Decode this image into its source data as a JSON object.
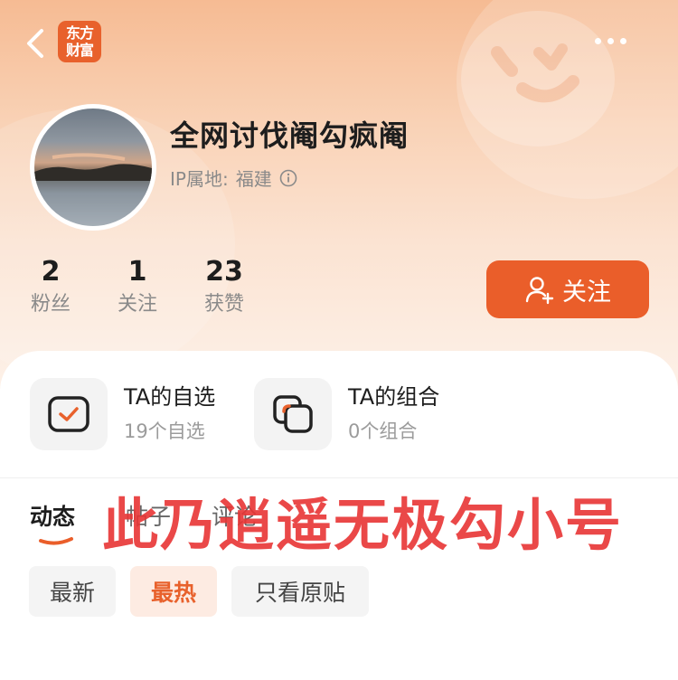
{
  "header": {
    "logo_line1": "东方",
    "logo_line2": "财富"
  },
  "profile": {
    "username": "全网讨伐阉勾疯阉",
    "ip_label": "IP属地:",
    "ip_value": "福建"
  },
  "stats": [
    {
      "value": "2",
      "label": "粉丝"
    },
    {
      "value": "1",
      "label": "关注"
    },
    {
      "value": "23",
      "label": "获赞"
    }
  ],
  "follow_button": {
    "label": "关注"
  },
  "entries": [
    {
      "title": "TA的自选",
      "subtitle": "19个自选"
    },
    {
      "title": "TA的组合",
      "subtitle": "0个组合"
    }
  ],
  "tabs": [
    {
      "label": "动态",
      "active": true
    },
    {
      "label": "帖子",
      "active": false
    },
    {
      "label": "评论",
      "active": false
    }
  ],
  "watermark": "此乃逍遥无极勾小号",
  "filters": [
    {
      "label": "最新",
      "active": false
    },
    {
      "label": "最热",
      "active": true
    },
    {
      "label": "只看原贴",
      "active": false
    }
  ],
  "colors": {
    "accent": "#ea5e2a",
    "watermark": "#e83434",
    "header_gradient_top": "#f6bb93"
  }
}
